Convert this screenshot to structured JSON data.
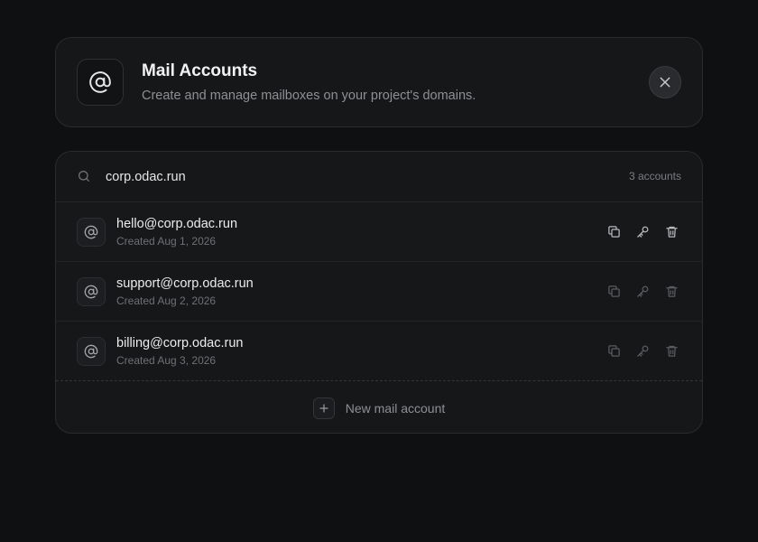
{
  "header": {
    "title": "Mail Accounts",
    "subtitle": "Create and manage mailboxes on your project's domains.",
    "icon": "at-sign-icon"
  },
  "search": {
    "value": "corp.odac.run",
    "count_label": "3 accounts"
  },
  "accounts": [
    {
      "email": "hello@corp.odac.run",
      "created": "Created Aug 1, 2026"
    },
    {
      "email": "support@corp.odac.run",
      "created": "Created Aug 2, 2026"
    },
    {
      "email": "billing@corp.odac.run",
      "created": "Created Aug 3, 2026"
    }
  ],
  "footer": {
    "new_label": "New mail account"
  },
  "colors": {
    "background": "#0f1012",
    "card": "#161719",
    "border": "#2a2b2e",
    "text_primary": "#ececee",
    "text_muted": "#8e8f94"
  }
}
